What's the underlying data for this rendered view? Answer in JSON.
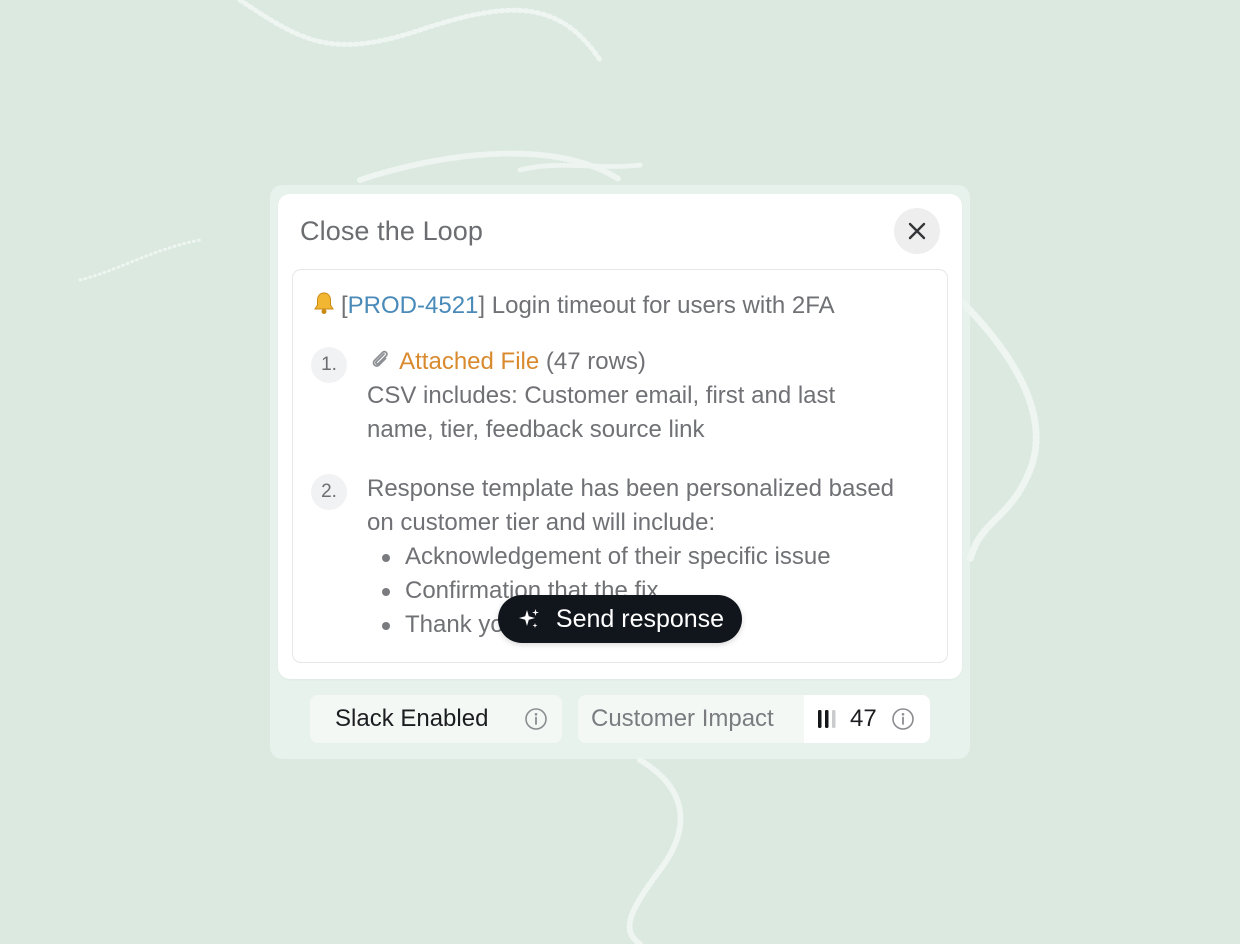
{
  "dialog": {
    "title": "Close the Loop"
  },
  "ticket": {
    "prefix": "[",
    "id": "PROD-4521",
    "suffix": "]",
    "summary": " Login timeout for users with 2FA"
  },
  "steps": [
    {
      "number": "1.",
      "link_text": "Attached File",
      "meta": " (47 rows)",
      "description": "CSV includes: Customer email, first and last name, tier, feedback source link"
    },
    {
      "number": "2.",
      "description": "Response template has been personalized based on customer tier and will include:",
      "bullets": [
        "Acknowledgement of their specific issue",
        "Confirmation that the fix",
        "Thank you"
      ]
    }
  ],
  "actions": {
    "send_label": "Send response"
  },
  "footer": {
    "slack_label": "Slack Enabled",
    "impact_label": "Customer Impact",
    "impact_value": "47"
  },
  "icons": {
    "close": "close-icon",
    "bell": "bell-icon",
    "clip": "paperclip-icon",
    "sparkle": "sparkle-icon",
    "info": "info-icon",
    "bars": "bars-icon"
  },
  "colors": {
    "background": "#dbe9e1",
    "link_blue": "#4a8ab8",
    "link_orange": "#d98a2e",
    "button_dark": "#11151c"
  }
}
